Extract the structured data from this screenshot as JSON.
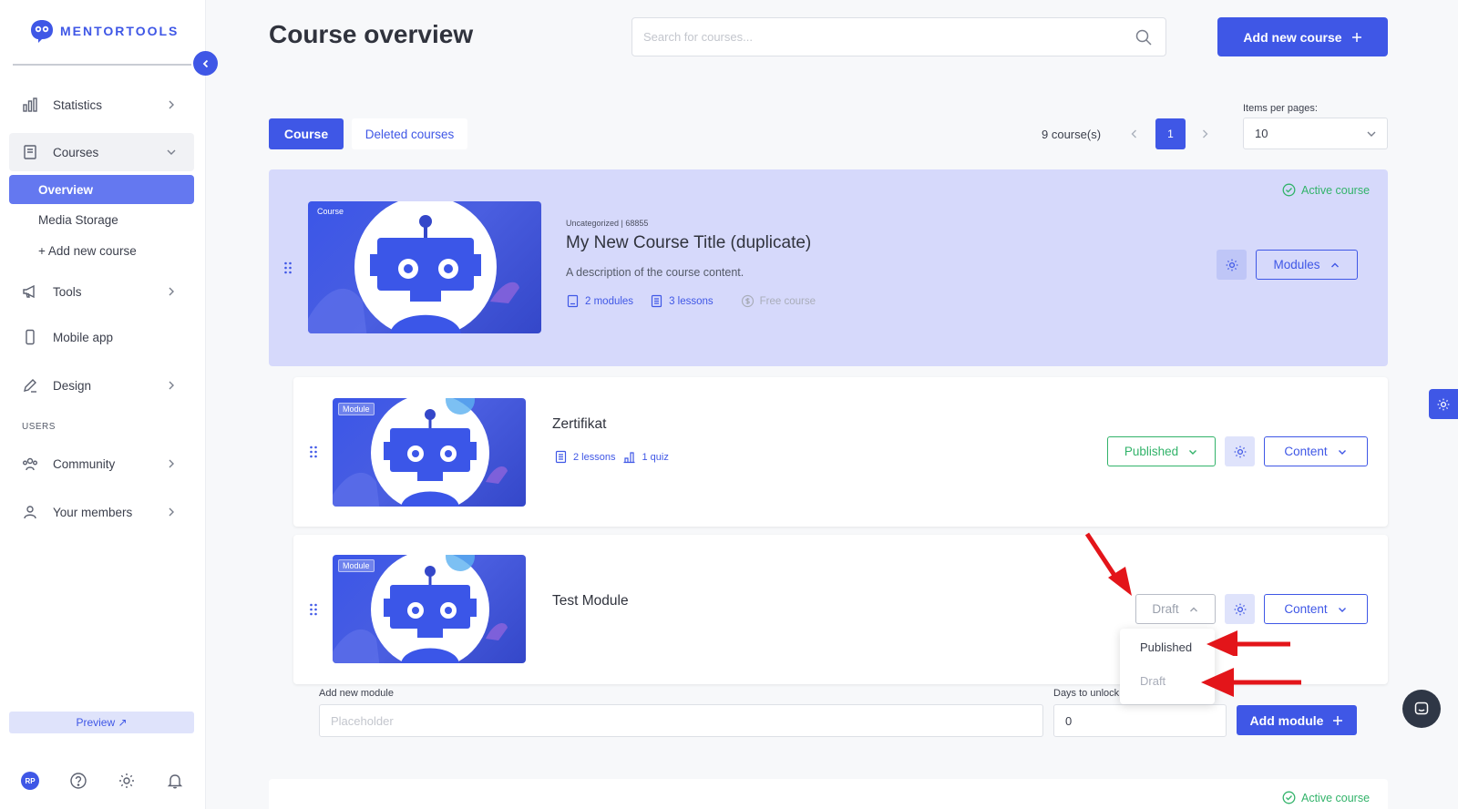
{
  "app": {
    "logo_text": "MENTORTOOLS"
  },
  "sidebar": {
    "items": [
      {
        "label": "Statistics",
        "icon": "bar-chart-icon"
      },
      {
        "label": "Courses",
        "icon": "book-icon"
      },
      {
        "label": "Tools",
        "icon": "megaphone-icon"
      },
      {
        "label": "Mobile app",
        "icon": "phone-icon"
      },
      {
        "label": "Design",
        "icon": "pen-icon"
      },
      {
        "label": "Community",
        "icon": "people-icon"
      },
      {
        "label": "Your members",
        "icon": "user-icon"
      }
    ],
    "sub_items": [
      "Overview",
      "Media Storage",
      "+ Add new course"
    ],
    "section_users": "USERS",
    "preview_label": "Preview ↗",
    "avatar_initials": "RP"
  },
  "header": {
    "title": "Course overview",
    "search_placeholder": "Search for courses...",
    "add_course_label": "Add new course"
  },
  "tabs": {
    "course": "Course",
    "deleted": "Deleted courses"
  },
  "pager": {
    "count": "9 course(s)",
    "current_page": "1",
    "items_per_page_label": "Items per pages:",
    "items_per_page_value": "10"
  },
  "course": {
    "tag": "Course",
    "active_label": "Active course",
    "meta": "Uncategorized | 68855",
    "title": "My New Course Title (duplicate)",
    "description": "A description of the course content.",
    "modules_count": "2 modules",
    "lessons_count": "3 lessons",
    "price": "Free course",
    "modules_button": "Modules"
  },
  "modules": [
    {
      "tag": "Module",
      "title": "Zertifikat",
      "lessons": "2 lessons",
      "quiz": "1 quiz",
      "status": "Published",
      "content_button": "Content"
    },
    {
      "tag": "Module",
      "title": "Test Module",
      "status": "Draft",
      "content_button": "Content"
    }
  ],
  "status_dropdown": {
    "options": [
      "Published",
      "Draft"
    ]
  },
  "add_module": {
    "label": "Add new module",
    "placeholder": "Placeholder",
    "days_label": "Days to unlock",
    "days_value": "0",
    "button": "Add module"
  },
  "next_course": {
    "active_label": "Active course"
  },
  "colors": {
    "primary": "#3f57e6",
    "success": "#32b36a",
    "course_bg": "#d6d9fb",
    "annotation": "#e3151a"
  }
}
